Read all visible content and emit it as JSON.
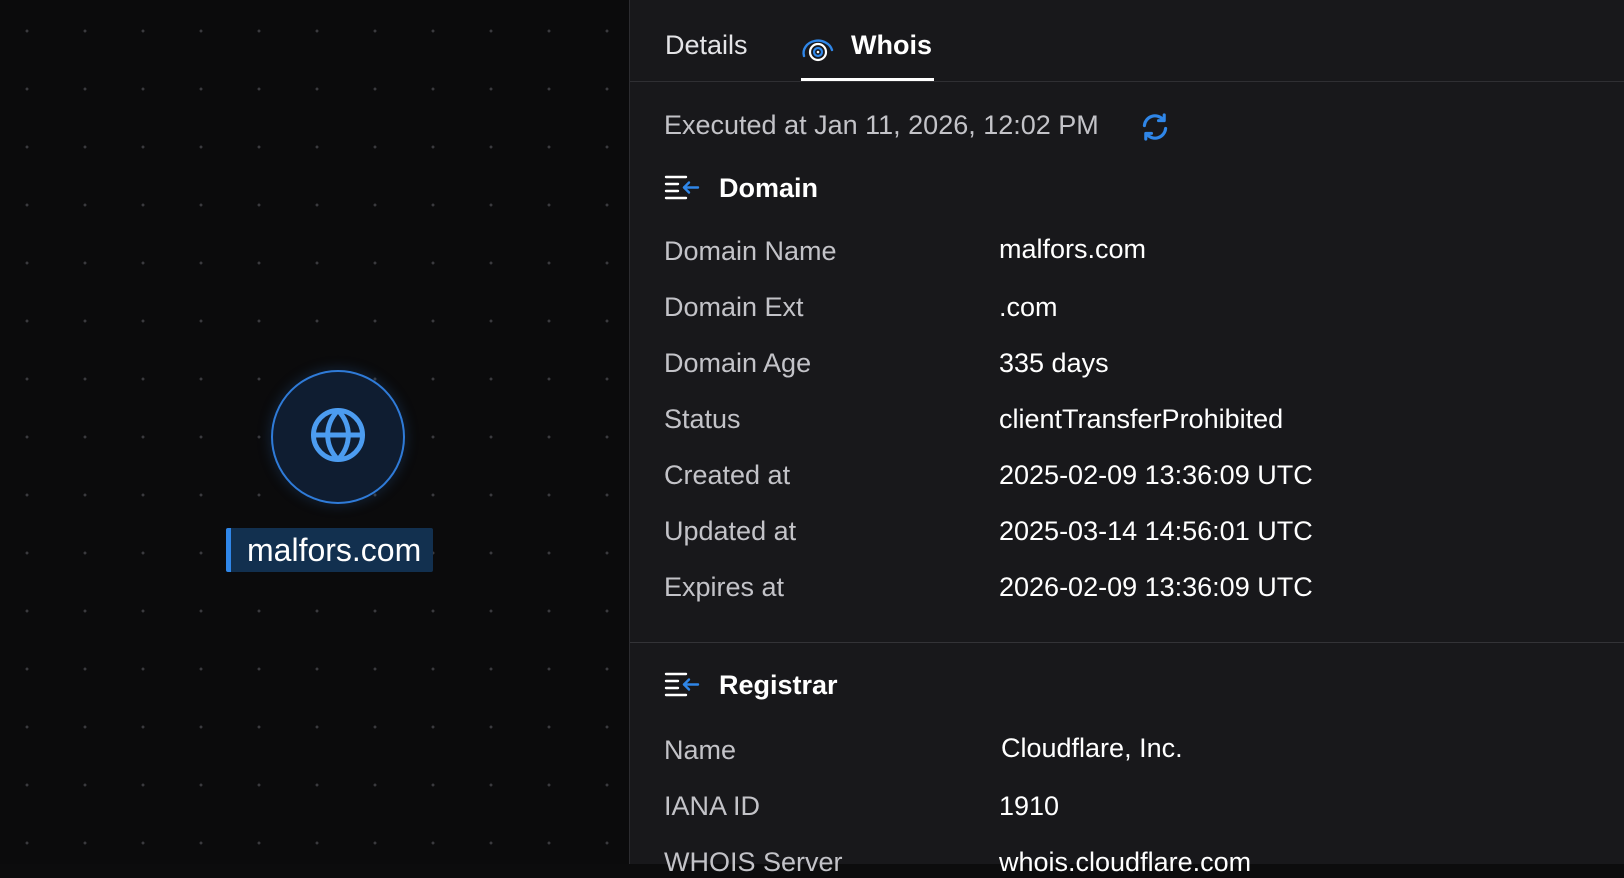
{
  "canvas": {
    "node_label": "malfors.com"
  },
  "tabs": [
    {
      "label": "Details",
      "active": false
    },
    {
      "label": "Whois",
      "active": true
    }
  ],
  "executed_text": "Executed at Jan 11, 2026, 12:02 PM",
  "domain_section": {
    "title": "Domain",
    "rows": [
      {
        "label": "Domain Name",
        "value": "malfors.com"
      },
      {
        "label": "Domain Ext",
        "value": ".com"
      },
      {
        "label": "Domain Age",
        "value": "335 days"
      },
      {
        "label": "Status",
        "value": "clientTransferProhibited"
      },
      {
        "label": "Created at",
        "value": "2025-02-09 13:36:09 UTC"
      },
      {
        "label": "Updated at",
        "value": "2025-03-14 14:56:01 UTC"
      },
      {
        "label": "Expires at",
        "value": "2026-02-09 13:36:09 UTC"
      }
    ]
  },
  "registrar_section": {
    "title": "Registrar",
    "rows": [
      {
        "label": "Name",
        "value": "Cloudflare, Inc."
      },
      {
        "label": "IANA ID",
        "value": "1910"
      },
      {
        "label": "WHOIS Server",
        "value": "whois.cloudflare.com"
      }
    ]
  },
  "colors": {
    "accent": "#2f86e8",
    "panel_bg": "#18181b",
    "canvas_bg": "#0b0b0c",
    "label_text": "#c3c3c8",
    "value_text": "#ffffff"
  },
  "icons": {
    "node": "globe-icon",
    "whois_tab": "whois-fingerprint-icon",
    "refresh": "refresh-icon",
    "section": "list-collapse-icon"
  }
}
